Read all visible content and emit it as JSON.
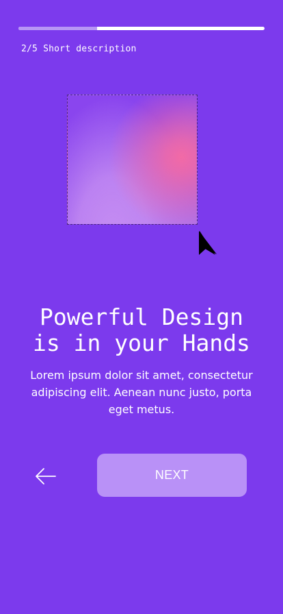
{
  "progress": {
    "current": 2,
    "total": 5,
    "fraction": 0.32
  },
  "step_label": "2/5 Short description",
  "headline": {
    "line1": "Powerful Design",
    "line2": "is in your Hands"
  },
  "body": "Lorem ipsum dolor sit amet, consectetur adipiscing elit. Aenean nunc justo, porta eget metus.",
  "actions": {
    "back_icon": "arrow-left-icon",
    "next_label": "NEXT"
  },
  "colors": {
    "background": "#7c3aed",
    "progress_track": "#ffffff",
    "progress_fill": "#b795f5",
    "button": "#b991f7",
    "text": "#ffffff"
  }
}
